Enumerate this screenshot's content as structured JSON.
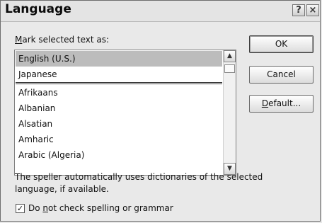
{
  "dialog": {
    "title": "Language",
    "help_button": "?",
    "close_button": "×"
  },
  "mark_label_prefix": "M",
  "mark_label_rest": "ark selected text as:",
  "list": {
    "items": [
      {
        "label": "English (U.S.)",
        "selected": true
      },
      {
        "label": "Japanese"
      },
      {
        "label": "Afrikaans"
      },
      {
        "label": "Albanian"
      },
      {
        "label": "Alsatian"
      },
      {
        "label": "Amharic"
      },
      {
        "label": "Arabic (Algeria)"
      }
    ],
    "scroll_up_glyph": "▲",
    "scroll_down_glyph": "▼"
  },
  "buttons": {
    "ok": "OK",
    "cancel": "Cancel",
    "default_prefix": "D",
    "default_rest": "efault..."
  },
  "info_text": "The speller automatically uses dictionaries of the selected language, if available.",
  "checkbox": {
    "checked": true,
    "glyph": "✓",
    "label_pre": "Do ",
    "label_underlined": "n",
    "label_post": "ot check spelling or grammar"
  }
}
